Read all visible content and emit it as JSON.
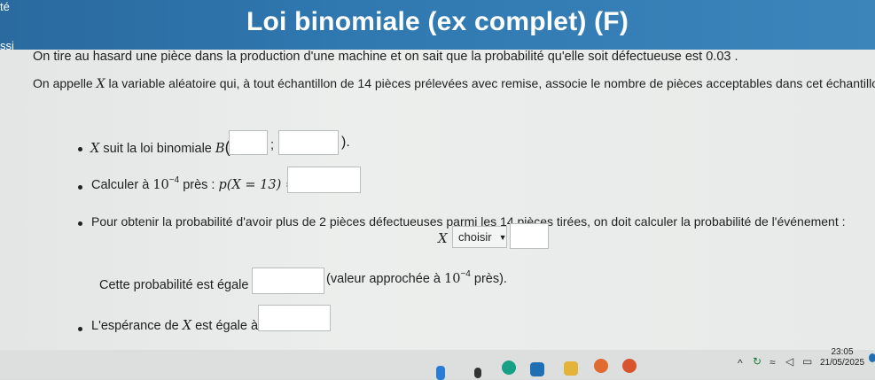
{
  "window": {
    "title": "Loi binomiale (ex complet) (F)",
    "corner_text_top": "té",
    "corner_text_side": "ssi"
  },
  "intro": {
    "line1": "On tire au hasard une pièce dans la production d'une machine et on sait que la probabilité qu'elle soit défectueuse est 0.03 .",
    "line2_a": "On appelle ",
    "line2_var": "X",
    "line2_b": " la variable aléatoire qui, à tout échantillon de 14 pièces prélevées avec remise, associe le nombre de pièces acceptables dans cet échantillon."
  },
  "q1": {
    "var": "X",
    "text": " suit la loi binomiale ",
    "law": "B",
    "open": "(",
    "sep": ";",
    "close": ")."
  },
  "q2": {
    "text": "Calculer à ",
    "base": "10",
    "exp": "−4",
    "text2": " près : ",
    "expr": "p(X = 13) ="
  },
  "q3": {
    "text": "Pour obtenir la probabilité d'avoir plus de 2 pièces défectueuses parmi les 14 pièces tirées, on doit calculer la probabilité de l'événement :",
    "var": "X",
    "select_value": "choisir",
    "result_a": "Cette probabilité est égale à",
    "result_b": "(valeur approchée à ",
    "base": "10",
    "exp": "−4",
    "result_c": " près)."
  },
  "q4": {
    "text_a": "L'espérance de ",
    "var": "X",
    "text_b": " est égale à"
  },
  "taskbar": {
    "time": "23:05",
    "date": "21/05/2025",
    "icons": [
      "windows-icon",
      "search-icon",
      "edge-icon",
      "store-icon",
      "explorer-icon",
      "firefox-icon",
      "firefox-icon"
    ]
  },
  "colors": {
    "header": "#2f78b0",
    "page": "#e8eae9"
  }
}
